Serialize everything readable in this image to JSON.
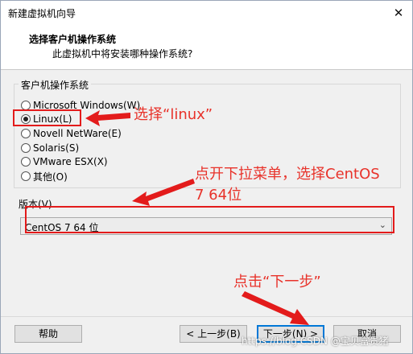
{
  "window": {
    "title": "新建虚拟机向导",
    "close_glyph": "✕"
  },
  "header": {
    "title": "选择客户机操作系统",
    "subtitle": "此虚拟机中将安装哪种操作系统?"
  },
  "os_group": {
    "legend": "客户机操作系统",
    "options": [
      {
        "label": "Microsoft Windows(W)",
        "checked": false
      },
      {
        "label": "Linux(L)",
        "checked": true
      },
      {
        "label": "Novell NetWare(E)",
        "checked": false
      },
      {
        "label": "Solaris(S)",
        "checked": false
      },
      {
        "label": "VMware ESX(X)",
        "checked": false
      },
      {
        "label": "其他(O)",
        "checked": false
      }
    ]
  },
  "version": {
    "label": "版本(V)",
    "selected": "CentOS 7 64 位",
    "chevron_icon": "chevron-down-icon"
  },
  "buttons": {
    "help": "帮助",
    "back": "< 上一步(B)",
    "next": "下一步(N) >",
    "cancel": "取消"
  },
  "annotations": {
    "select_linux": "选择“linux”",
    "open_dropdown_line1": "点开下拉菜单，选择CentOS",
    "open_dropdown_line2": "7 64位",
    "click_next": "点击“下一步”",
    "color": "#e8322a"
  },
  "watermark": "https://blog.CSDN @宝贝富贵猪"
}
